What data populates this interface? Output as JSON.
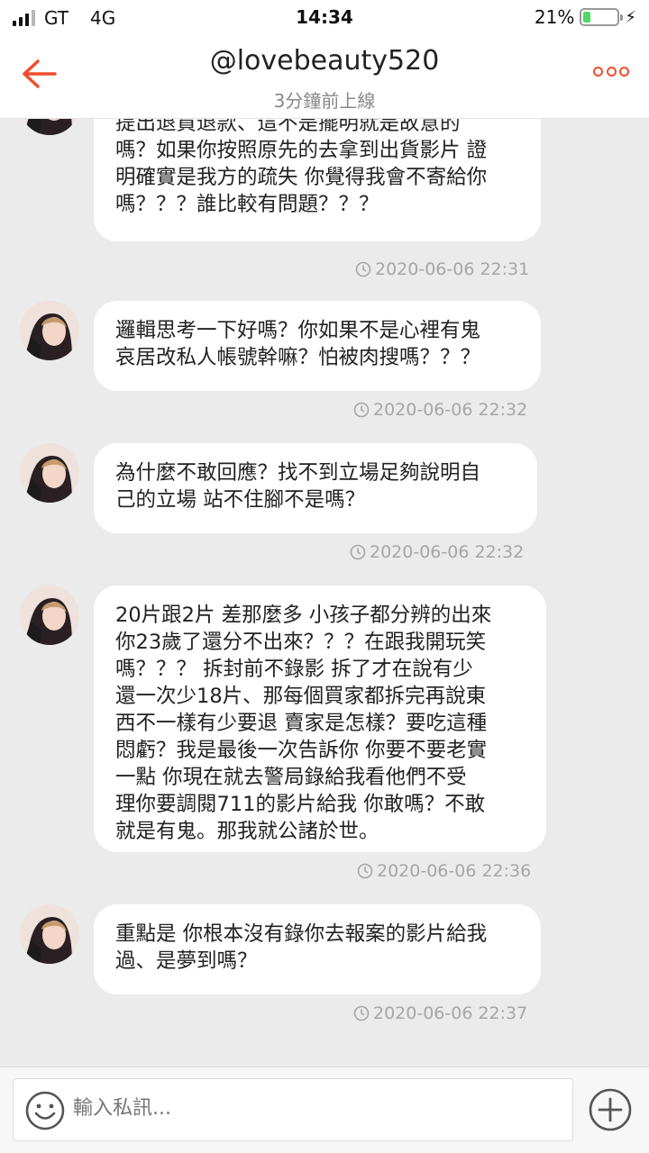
{
  "status_bar": {
    "carrier": "GT",
    "network": "4G",
    "time": "14:34",
    "battery_percent_text": "21%",
    "battery_level": 0.21,
    "colors": {
      "battery_fill": "#4cd964"
    }
  },
  "header": {
    "title": "@lovebeauty520",
    "subtitle": "3分鐘前上線",
    "back_icon": "arrow-left-icon",
    "more_icon": "more-dots-icon",
    "accent_color": "#ee4d2d"
  },
  "messages": [
    {
      "text": "再來 你用者蝦皮的機制問題 故意三天內\n提出退貨退款、這不是擺明就是故意的\n嗎？如果你按照原先的去拿到出貨影片 證\n明確實是我方的疏失 你覺得我會不寄給你\n嗎？？？誰比較有問題？？？",
      "time": "2020-06-06 22:31"
    },
    {
      "text": "邏輯思考一下好嗎？你如果不是心裡有鬼\n哀居改私人帳號幹嘛？怕被肉搜嗎？？？",
      "time": "2020-06-06 22:32"
    },
    {
      "text": "為什麼不敢回應？找不到立場足夠說明自\n己的立場 站不住腳不是嗎？",
      "time": "2020-06-06 22:32"
    },
    {
      "text": "20片跟2片 差那麼多 小孩子都分辨的出來\n你23歲了還分不出來？？？在跟我開玩笑\n嗎？？？ 拆封前不錄影 拆了才在說有少\n還一次少18片、那每個買家都拆完再說東\n西不一樣有少要退 賣家是怎樣？要吃這種\n悶虧？我是最後一次告訴你 你要不要老實\n一點 你現在就去警局錄給我看他們不受\n理你要調閱711的影片給我 你敢嗎？不敢\n就是有鬼。那我就公諸於世。",
      "time": "2020-06-06 22:36"
    },
    {
      "text": "重點是 你根本沒有錄你去報案的影片給我\n過、是夢到嗎？",
      "time": "2020-06-06 22:37"
    }
  ],
  "input_bar": {
    "placeholder": "輸入私訊...",
    "emoji_icon": "smiley-icon",
    "add_icon": "plus-circle-icon"
  }
}
